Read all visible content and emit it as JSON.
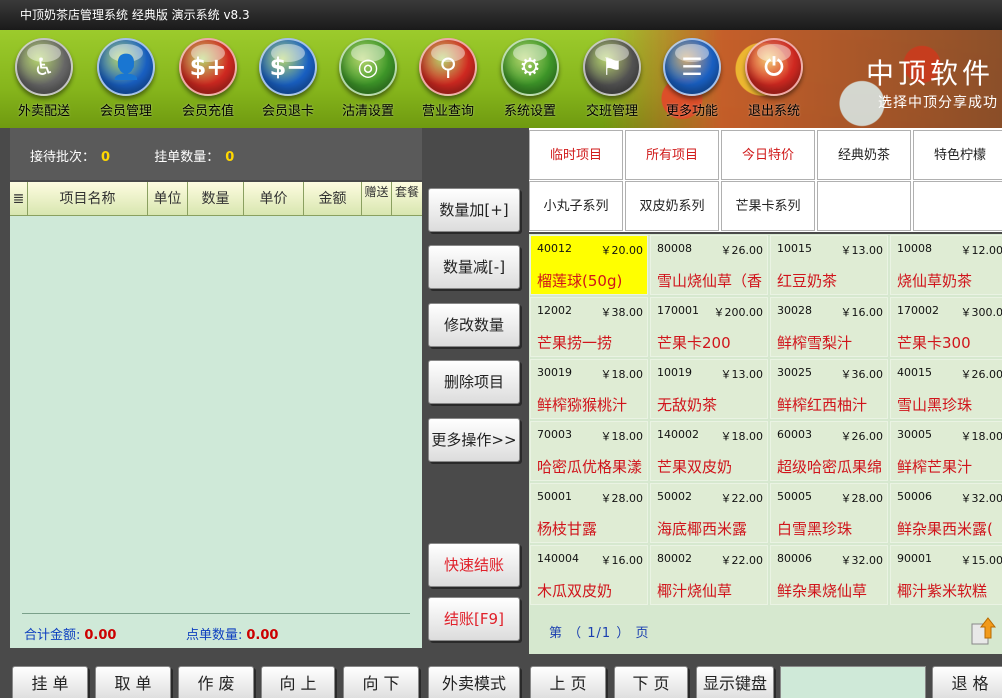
{
  "window": {
    "title": "中顶奶茶店管理系统 经典版 演示系统 v8.3"
  },
  "toolbar": {
    "brand": "中顶软件",
    "slogan": "选择中顶分享成功",
    "items": [
      {
        "label": "外卖配送",
        "icon": "scooter-icon",
        "color": "#6b6b6b"
      },
      {
        "label": "会员管理",
        "icon": "user-icon",
        "color": "#1a63c9"
      },
      {
        "label": "会员充值",
        "icon": "recharge-card-icon",
        "color": "#d62a22"
      },
      {
        "label": "会员退卡",
        "icon": "refund-card-icon",
        "color": "#1a63c9"
      },
      {
        "label": "沽清设置",
        "icon": "plate-icon",
        "color": "#3f9a2a"
      },
      {
        "label": "营业查询",
        "icon": "magnifier-icon",
        "color": "#d62a22"
      },
      {
        "label": "系统设置",
        "icon": "gear-icon",
        "color": "#3f9a2a"
      },
      {
        "label": "交班管理",
        "icon": "meeting-icon",
        "color": "#555555"
      },
      {
        "label": "更多功能",
        "icon": "list-icon",
        "color": "#1a63c9"
      },
      {
        "label": "退出系统",
        "icon": "power-icon",
        "color": "#d62a22"
      }
    ]
  },
  "summary": {
    "batch_label": "接待批次：",
    "batch_value": "0",
    "pending_label": "挂单数量：",
    "pending_value": "0"
  },
  "order_table": {
    "columns": [
      "≣",
      "项目名称",
      "单位",
      "数量",
      "单价",
      "金额",
      "赠送",
      "套餐"
    ],
    "rows": [],
    "total_label": "合计金额:",
    "total_value": "0.00",
    "count_label": "点单数量:",
    "count_value": "0.00"
  },
  "actions": {
    "qty_plus": "数量加[+]",
    "qty_minus": "数量减[-]",
    "edit_qty": "修改数量",
    "delete_item": "删除项目",
    "more_ops": "更多操作>>",
    "quick_checkout": "快速结账",
    "checkout": "结账[F9]"
  },
  "categories": [
    {
      "label": "临时项目",
      "color": "#d01a1a"
    },
    {
      "label": "所有项目",
      "color": "#d01a1a"
    },
    {
      "label": "今日特价",
      "color": "#d01a1a"
    },
    {
      "label": "经典奶茶",
      "color": "#222222"
    },
    {
      "label": "特色柠檬",
      "color": "#222222"
    },
    {
      "label": "小丸子系列",
      "color": "#222222"
    },
    {
      "label": "双皮奶系列",
      "color": "#222222"
    },
    {
      "label": "芒果卡系列",
      "color": "#222222"
    },
    {
      "label": "",
      "color": "#222222"
    },
    {
      "label": "",
      "color": "#222222"
    }
  ],
  "products": [
    {
      "code": "40012",
      "price": "￥20.00",
      "name": "榴莲球(50g)",
      "highlight": true
    },
    {
      "code": "80008",
      "price": "￥26.00",
      "name": "雪山烧仙草（香",
      "highlight": false
    },
    {
      "code": "10015",
      "price": "￥13.00",
      "name": "红豆奶茶",
      "highlight": false
    },
    {
      "code": "10008",
      "price": "￥12.00",
      "name": "烧仙草奶茶",
      "highlight": false
    },
    {
      "code": "12002",
      "price": "￥38.00",
      "name": "芒果捞一捞",
      "highlight": false
    },
    {
      "code": "170001",
      "price": "￥200.00",
      "name": "芒果卡200",
      "highlight": false
    },
    {
      "code": "30028",
      "price": "￥16.00",
      "name": "鲜榨雪梨汁",
      "highlight": false
    },
    {
      "code": "170002",
      "price": "￥300.0",
      "name": "芒果卡300",
      "highlight": false
    },
    {
      "code": "30019",
      "price": "￥18.00",
      "name": "鲜榨猕猴桃汁",
      "highlight": false
    },
    {
      "code": "10019",
      "price": "￥13.00",
      "name": "无敌奶茶",
      "highlight": false
    },
    {
      "code": "30025",
      "price": "￥36.00",
      "name": "鲜榨红西柚汁",
      "highlight": false
    },
    {
      "code": "40015",
      "price": "￥26.00",
      "name": "雪山黑珍珠",
      "highlight": false
    },
    {
      "code": "70003",
      "price": "￥18.00",
      "name": "哈密瓜优格果漾",
      "highlight": false
    },
    {
      "code": "140002",
      "price": "￥18.00",
      "name": "芒果双皮奶",
      "highlight": false
    },
    {
      "code": "60003",
      "price": "￥26.00",
      "name": "超级哈密瓜果绵",
      "highlight": false
    },
    {
      "code": "30005",
      "price": "￥18.00",
      "name": "鲜榨芒果汁",
      "highlight": false
    },
    {
      "code": "50001",
      "price": "￥28.00",
      "name": "杨枝甘露",
      "highlight": false
    },
    {
      "code": "50002",
      "price": "￥22.00",
      "name": "海底椰西米露",
      "highlight": false
    },
    {
      "code": "50005",
      "price": "￥28.00",
      "name": "白雪黑珍珠",
      "highlight": false
    },
    {
      "code": "50006",
      "price": "￥32.00",
      "name": "鲜杂果西米露(",
      "highlight": false
    },
    {
      "code": "140004",
      "price": "￥16.00",
      "name": "木瓜双皮奶",
      "highlight": false
    },
    {
      "code": "80002",
      "price": "￥22.00",
      "name": "椰汁烧仙草",
      "highlight": false
    },
    {
      "code": "80006",
      "price": "￥32.00",
      "name": "鲜杂果烧仙草",
      "highlight": false
    },
    {
      "code": "90001",
      "price": "￥15.00",
      "name": "椰汁紫米软糕",
      "highlight": false
    }
  ],
  "pager": {
    "text": "第  （ 1/1 ） 页"
  },
  "bottom_bar": {
    "hold": "挂 单",
    "retrieve": "取 单",
    "void": "作 废",
    "up": "向 上",
    "down": "向 下",
    "takeaway_mode": "外卖模式",
    "prev_page": "上 页",
    "next_page": "下 页",
    "show_keyboard": "显示键盘",
    "backspace": "退 格"
  }
}
